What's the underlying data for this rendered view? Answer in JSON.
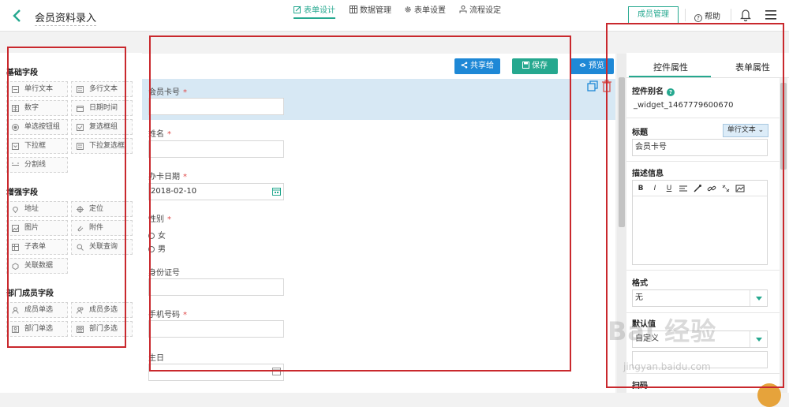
{
  "header": {
    "title": "会员资料录入",
    "member_mgmt": "成员管理",
    "help": "帮助"
  },
  "left_panel": {
    "basic": {
      "title": "基础字段",
      "items": [
        "单行文本",
        "多行文本",
        "数字",
        "日期时间",
        "单选按钮组",
        "复选框组",
        "下拉框",
        "下拉复选框",
        "分割线"
      ]
    },
    "enhanced": {
      "title": "增强字段",
      "items": [
        "地址",
        "定位",
        "图片",
        "附件",
        "子表单",
        "关联查询",
        "关联数据"
      ]
    },
    "dept": {
      "title": "部门成员字段",
      "items": [
        "成员单选",
        "成员多选",
        "部门单选",
        "部门多选"
      ]
    }
  },
  "tabs": [
    "表单设计",
    "数据管理",
    "表单设置",
    "流程设定"
  ],
  "actions": {
    "share": "共享给",
    "save": "保存",
    "preview": "预览"
  },
  "form": {
    "card_no_label": "会员卡号",
    "name_label": "姓名",
    "issue_date_label": "办卡日期",
    "issue_date_value": "2018-02-10",
    "gender_label": "性别",
    "gender_options": [
      "女",
      "男"
    ],
    "id_label": "身份证号",
    "phone_label": "手机号码",
    "birthday_label": "生日",
    "required_mark": "*"
  },
  "right_panel": {
    "tab_control": "控件属性",
    "tab_form": "表单属性",
    "alias_label": "控件别名",
    "alias_value": "_widget_1467779600670",
    "title_label": "标题",
    "type_badge": "单行文本",
    "title_value": "会员卡号",
    "desc_label": "描述信息",
    "toolbar": [
      "B",
      "I",
      "U"
    ],
    "format_label": "格式",
    "format_value": "无",
    "default_label": "默认值",
    "default_value": "自定义",
    "scan_label": "扫码"
  },
  "watermark": {
    "main": "Bai 经验",
    "sub": "jingyan.baidu.com"
  },
  "colors": {
    "accent": "#25a88f",
    "share_btn": "#1e88d6",
    "save_btn": "#25a88f",
    "preview_btn": "#1e88d6",
    "selected_row": "#d7e8f4",
    "annotation_red": "#c9282d"
  }
}
